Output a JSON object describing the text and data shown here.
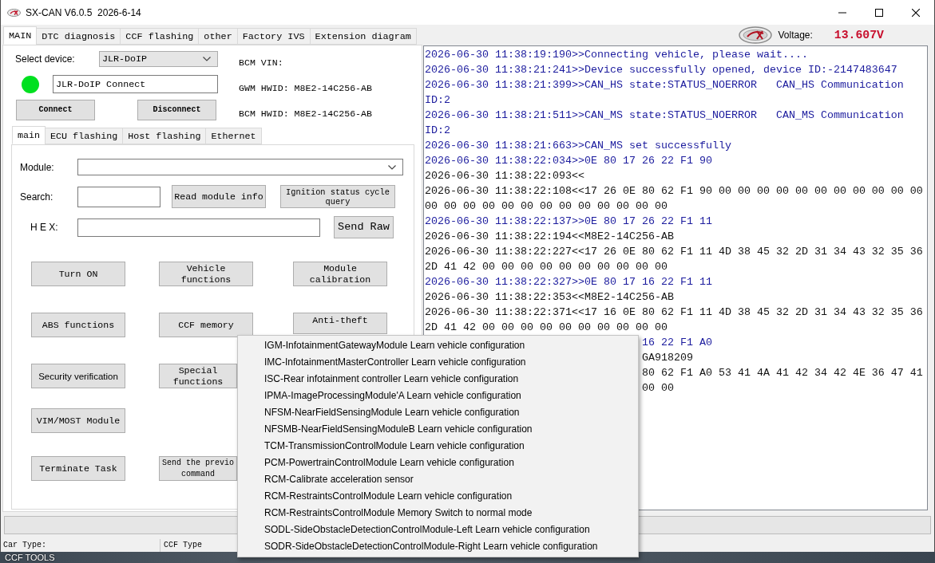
{
  "window": {
    "title": "SX-CAN V6.0.5  2026-6-14"
  },
  "main_tabs": [
    {
      "label": "MAIN",
      "selected": true
    },
    {
      "label": "DTC diagnosis",
      "selected": false
    },
    {
      "label": "CCF flashing",
      "selected": false
    },
    {
      "label": "other",
      "selected": false
    },
    {
      "label": "Factory IVS",
      "selected": false
    },
    {
      "label": "Extension diagram",
      "selected": false
    }
  ],
  "voltage": {
    "label": "Voltage:",
    "value": "13.607V"
  },
  "device": {
    "label": "Select device:",
    "selected_device": "JLR-DoIP",
    "connected": true,
    "connection": "JLR-DoIP Connect",
    "connect_button": "Connect",
    "disconnect_button": "Disconnect"
  },
  "vehicle_info": [
    "BCM VIN:",
    "GWM HWID: M8E2-14C256-AB",
    "BCM HWID: M8E2-14C256-AB"
  ],
  "sub_tabs": [
    {
      "label": "main",
      "selected": true
    },
    {
      "label": "ECU flashing",
      "selected": false
    },
    {
      "label": "Host flashing",
      "selected": false
    },
    {
      "label": "Ethernet",
      "selected": false
    }
  ],
  "module_panel": {
    "module_label": "Module:",
    "search_label": "Search:",
    "read_button": "Read module info",
    "ignition_button": "Ignition status cycle query",
    "hex_label": "H E X:",
    "send_button": "Send Raw"
  },
  "function_buttons": [
    [
      {
        "label": "Turn ON",
        "kind": "mono",
        "covered_right": false,
        "covered_bottom": false
      },
      {
        "label": "Vehicle functions",
        "kind": "mono",
        "covered_right": false,
        "covered_bottom": false
      },
      {
        "label": "Module calibration",
        "kind": "mono",
        "covered_right": false,
        "covered_bottom": false
      }
    ],
    [
      {
        "label": "ABS functions",
        "kind": "mono",
        "covered_right": false,
        "covered_bottom": false
      },
      {
        "label": "CCF memory",
        "kind": "mono",
        "covered_right": false,
        "covered_bottom": false
      },
      {
        "label": "Anti-theft",
        "kind": "mono",
        "covered_right": false,
        "covered_bottom": true
      }
    ],
    [
      {
        "label": "Security verification",
        "kind": "sans",
        "covered_right": false,
        "covered_bottom": false
      },
      {
        "label": "Special functions",
        "kind": "mono",
        "covered_right": true,
        "covered_bottom": false
      }
    ],
    [
      {
        "label": "VIM/MOST Module",
        "kind": "mono",
        "covered_right": false,
        "covered_bottom": false
      }
    ],
    [
      {
        "label": "Terminate Task",
        "kind": "mono",
        "covered_right": false,
        "covered_bottom": false
      },
      {
        "label": "Send the previo command",
        "kind": "small",
        "covered_right": true,
        "covered_bottom": false
      }
    ]
  ],
  "log": [
    {
      "kind": "sent",
      "covered": false,
      "text": "2026-06-30 11:38:19:190>>Connecting vehicle, please wait...."
    },
    {
      "kind": "sent",
      "covered": false,
      "text": "2026-06-30 11:38:21:241>>Device successfully opened, device ID:-2147483647"
    },
    {
      "kind": "sent",
      "covered": false,
      "text": "2026-06-30 11:38:21:399>>CAN_HS state:STATUS_NOERROR   CAN_HS Communication ID:2"
    },
    {
      "kind": "sent",
      "covered": false,
      "text": "2026-06-30 11:38:21:511>>CAN_MS state:STATUS_NOERROR   CAN_MS Communication ID:2"
    },
    {
      "kind": "sent",
      "covered": false,
      "text": "2026-06-30 11:38:21:663>>CAN_MS set successfully"
    },
    {
      "kind": "sent",
      "covered": false,
      "text": "2026-06-30 11:38:22:034>>0E 80 17 26 22 F1 90"
    },
    {
      "kind": "received",
      "covered": false,
      "text": "2026-06-30 11:38:22:093<<"
    },
    {
      "kind": "received",
      "covered": false,
      "text": "2026-06-30 11:38:22:108<<17 26 0E 80 62 F1 90 00 00 00 00 00 00 00 00 00 00 00 00 00 00 00 00 00 00 00 00 00 00 00 00"
    },
    {
      "kind": "sent",
      "covered": false,
      "text": "2026-06-30 11:38:22:137>>0E 80 17 26 22 F1 11"
    },
    {
      "kind": "received",
      "covered": false,
      "text": "2026-06-30 11:38:22:194<<M8E2-14C256-AB"
    },
    {
      "kind": "received",
      "covered": false,
      "text": "2026-06-30 11:38:22:227<<17 26 0E 80 62 F1 11 4D 38 45 32 2D 31 34 43 32 35 36 2D 41 42 00 00 00 00 00 00 00 00 00 00"
    },
    {
      "kind": "sent",
      "covered": false,
      "text": "2026-06-30 11:38:22:327>>0E 80 17 16 22 F1 11"
    },
    {
      "kind": "received",
      "covered": false,
      "text": "2026-06-30 11:38:22:353<<M8E2-14C256-AB"
    },
    {
      "kind": "received",
      "covered": false,
      "text": "2026-06-30 11:38:22:371<<17 16 0E 80 62 F1 11 4D 38 45 32 2D 31 34 43 32 35 36 2D 41 42 00 00 00 00 00 00 00 00 00 00"
    },
    {
      "kind": "sent",
      "covered": true,
      "text": "16 22 F1 A0"
    },
    {
      "kind": "received",
      "covered": true,
      "text": "GA918209"
    },
    {
      "kind": "received",
      "covered": true,
      "text": "80 62 F1 A0 53 41 4A 41 42 34 42 4E 36 47 41"
    },
    {
      "kind": "received",
      "covered": true,
      "text": "00 00"
    }
  ],
  "context_menu": {
    "items": [
      "IGM-InfotainmentGatewayModule Learn vehicle configuration",
      "IMC-InfotainmentMasterController Learn vehicle configuration",
      "ISC-Rear infotainment controller Learn vehicle configuration",
      "IPMA-ImageProcessingModule'A Learn vehicle configuration",
      "NFSM-NearFieldSensingModule Learn vehicle configuration",
      "NFSMB-NearFieldSensingModuleB Learn vehicle configuration",
      "TCM-TransmissionControlModule Learn vehicle configuration",
      "PCM-PowertrainControlModule Learn vehicle configuration",
      "RCM-Calibrate acceleration sensor",
      "RCM-RestraintsControlModule Learn vehicle configuration",
      "RCM-RestraintsControlModule Memory Switch to normal mode",
      "SODL-SideObstacleDetectionControlModule-Left Learn vehicle configuration",
      "SODR-SideObstacleDetectionControlModule-Right Learn vehicle configuration"
    ]
  },
  "progress_bar": {
    "level": 0
  },
  "status_bar": {
    "car_type": "Car Type:",
    "ccf_type": "CCF Type"
  },
  "desktop": {
    "icon_label": "CCF TOOLS"
  }
}
